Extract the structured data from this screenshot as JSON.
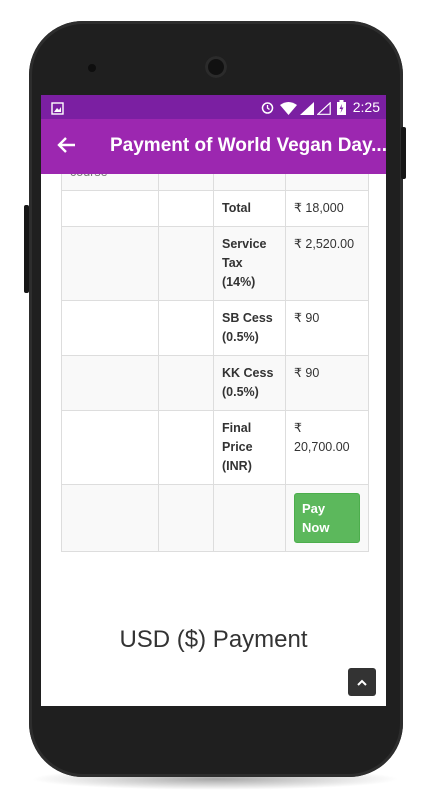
{
  "status_bar": {
    "time": "2:25"
  },
  "app_bar": {
    "back_icon": "arrow-left-icon",
    "title": "Payment of World Vegan Day..."
  },
  "price_table": {
    "partial_top_text": "course",
    "rows": [
      {
        "label": "Total",
        "value": "₹ 18,000"
      },
      {
        "label": "Service Tax (14%)",
        "value": "₹ 2,520.00"
      },
      {
        "label": "SB Cess (0.5%)",
        "value": "₹ 90"
      },
      {
        "label": "KK Cess (0.5%)",
        "value": "₹ 90"
      },
      {
        "label": "Final Price (INR)",
        "value": "₹ 20,700.00"
      }
    ],
    "pay_button": "Pay Now"
  },
  "usd_section": {
    "heading": "USD ($) Payment"
  },
  "scroll_top_icon": "chevron-up-icon",
  "colors": {
    "status_bar": "#7b1fa2",
    "app_bar": "#9c27b0",
    "pay_button": "#5cb85c"
  }
}
